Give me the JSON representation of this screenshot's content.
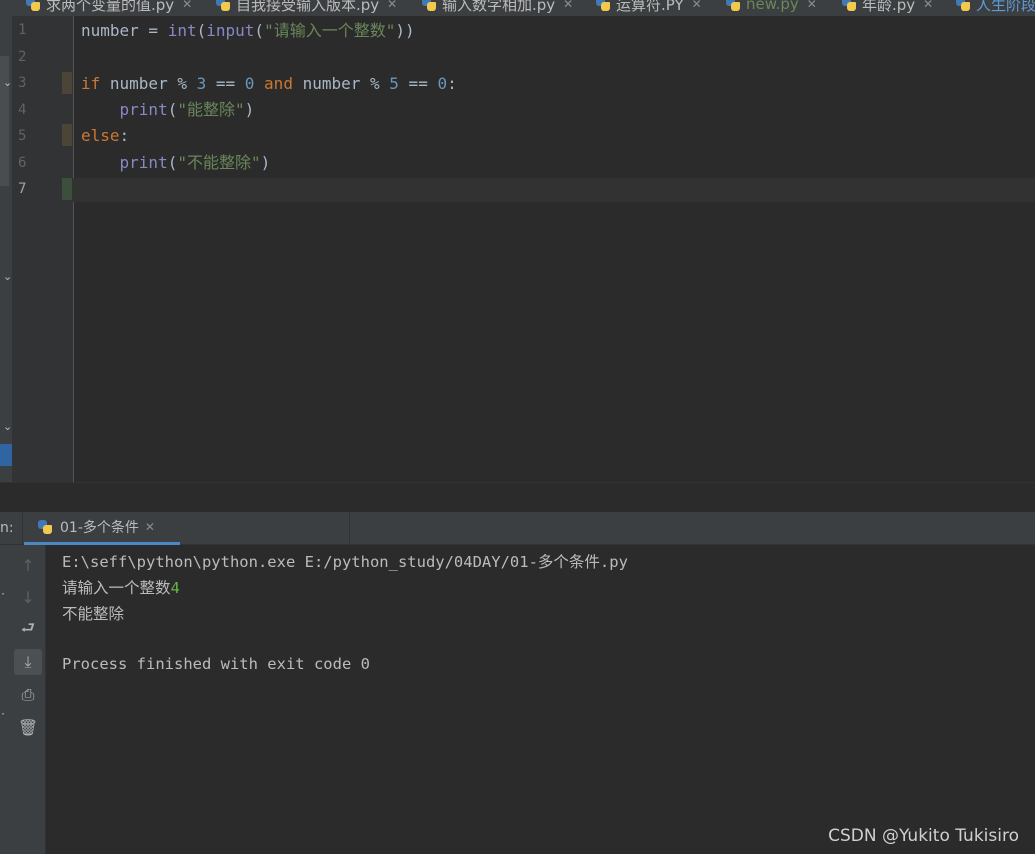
{
  "editor_tabs": [
    {
      "label": "求两个变量的值.py"
    },
    {
      "label": "自我接受输入版本.py"
    },
    {
      "label": "输入数字相加.py"
    },
    {
      "label": "运算符.PY"
    },
    {
      "label": "new.py"
    },
    {
      "label": "年龄.py"
    },
    {
      "label": "人生阶段"
    }
  ],
  "line_numbers": [
    "1",
    "2",
    "3",
    "4",
    "5",
    "6",
    "7"
  ],
  "code": {
    "line1": {
      "var": "number",
      "op": " = ",
      "fn1": "int",
      "p1": "(",
      "fn2": "input",
      "p2": "(",
      "str": "\"请输入一个整数\"",
      "p3": "))"
    },
    "line3": {
      "kw1": "if",
      "a": " number % ",
      "n1": "3",
      "b": " == ",
      "n2": "0",
      "c": " ",
      "kw2": "and",
      "d": " number % ",
      "n3": "5",
      "e": " == ",
      "n4": "0",
      "f": ":"
    },
    "line4": {
      "indent": "    ",
      "fn": "print",
      "p1": "(",
      "str": "\"能整除\"",
      "p2": ")"
    },
    "line5": {
      "kw": "else",
      "p": ":"
    },
    "line6": {
      "indent": "    ",
      "fn": "print",
      "p1": "(",
      "str": "\"不能整除\"",
      "p2": ")"
    }
  },
  "run_panel": {
    "label": "n:",
    "tab_label": "01-多个条件"
  },
  "console": {
    "command": "E:\\seff\\python\\python.exe E:/python_study/04DAY/01-多个条件.py",
    "prompt": "请输入一个整数",
    "user_input": "4",
    "result": "不能整除",
    "exit_message": "Process finished with exit code 0"
  },
  "watermark": "CSDN @Yukito Tukisiro"
}
